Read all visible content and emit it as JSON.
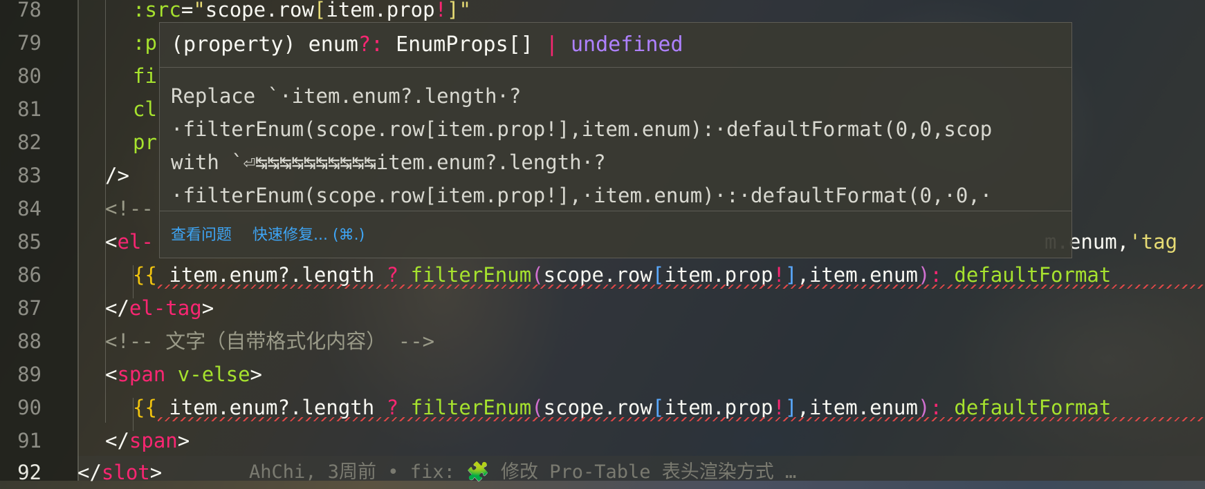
{
  "line_numbers": [
    "78",
    "79",
    "80",
    "81",
    "82",
    "83",
    "84",
    "85",
    "86",
    "87",
    "88",
    "89",
    "90",
    "91",
    "92"
  ],
  "lines": {
    "l78": {
      "attr": ":src",
      "eq": "=",
      "q1": "\"",
      "scope": "scope.row",
      "lb": "[",
      "prop": "item.prop",
      "bang": "!",
      "rb": "]",
      "q2": "\""
    },
    "l79": {
      "text": ":p"
    },
    "l80": {
      "text": "fi"
    },
    "l81": {
      "text": "cl"
    },
    "l82": {
      "text": "pr"
    },
    "l83": {
      "text": "/>"
    },
    "l84": {
      "text": "<!--"
    },
    "l85": {
      "lt": "<",
      "tag": "el-",
      "tail1": "m.enum,",
      "tail2": "'tag"
    },
    "l86": {
      "open": "{{",
      "a": " item.enum?.length ",
      "q": "?",
      "sp": " ",
      "fn": "filterEnum",
      "lp": "(",
      "scope": "scope.row",
      "lb": "[",
      "prop": "item.prop",
      "bang": "!",
      "rb": "]",
      "b": ",item.enum",
      "rp": ")",
      "colon": ":",
      "fn2": " defaultFormat"
    },
    "l87": {
      "lt": "</",
      "tag": "el-tag",
      "gt": ">"
    },
    "l88": {
      "text": "<!-- 文字（自带格式化内容） -->"
    },
    "l89": {
      "lt": "<",
      "tag": "span",
      "attr": " v-else",
      "gt": ">"
    },
    "l90": {
      "open": "{{",
      "a": " item.enum?.length ",
      "q": "?",
      "sp": " ",
      "fn": "filterEnum",
      "lp": "(",
      "scope": "scope.row",
      "lb": "[",
      "prop": "item.prop",
      "bang": "!",
      "rb": "]",
      "b": ",item.enum",
      "rp": ")",
      "colon": ":",
      "fn2": " defaultFormat"
    },
    "l91": {
      "lt": "</",
      "tag": "span",
      "gt": ">"
    },
    "l92": {
      "lt": "</",
      "tag": "slot",
      "gt": ">"
    }
  },
  "blame": "AhChi, 3周前 • fix: 🧩 修改 Pro-Table 表头渲染方式 …",
  "hover": {
    "sig_a": "(property) enum",
    "sig_q": "?:",
    "sig_b": " EnumProps[] ",
    "sig_pipe": "|",
    "sig_undef": " undefined",
    "msg": [
      "Replace `·item.enum?.length·?",
      "·filterEnum(scope.row[item.prop!],item.enum):·defaultFormat(0,0,scop",
      "with `⏎↹↹↹↹↹↹↹↹↹↹item.enum?.length·?",
      "·filterEnum(scope.row[item.prop!],·item.enum)·:·defaultFormat(0,·0,·"
    ],
    "actions": {
      "view_problem": "查看问题",
      "quick_fix": "快速修复... (⌘.)"
    }
  },
  "colors": {
    "tag": "#f92672",
    "attr": "#a6e22e",
    "string": "#e6db74",
    "comment": "#9a9a88",
    "link": "#3ea5f5",
    "error": "#e04848"
  }
}
